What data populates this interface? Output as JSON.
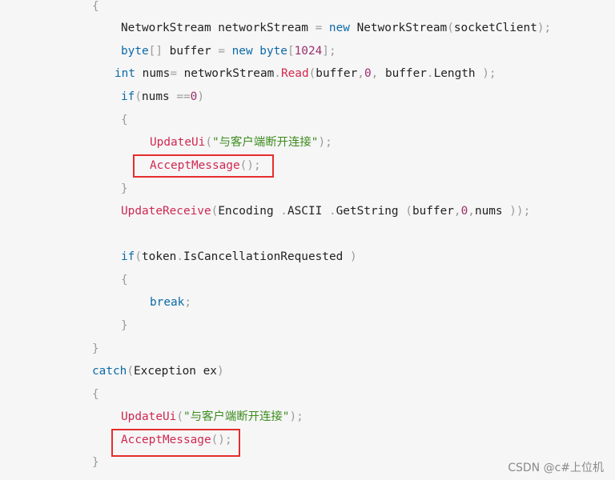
{
  "code": {
    "lines": [
      {
        "tokens": [
          {
            "t": "{",
            "c": "punc"
          }
        ]
      },
      {
        "tokens": [
          {
            "t": "NetworkStream networkStream ",
            "c": "plain"
          },
          {
            "t": "= ",
            "c": "punc"
          },
          {
            "t": "new ",
            "c": "kw"
          },
          {
            "t": "NetworkStream",
            "c": "plain"
          },
          {
            "t": "(",
            "c": "punc"
          },
          {
            "t": "socketClient",
            "c": "plain"
          },
          {
            "t": ");",
            "c": "punc"
          }
        ]
      },
      {
        "tokens": [
          {
            "t": "byte",
            "c": "kw"
          },
          {
            "t": "[] ",
            "c": "punc"
          },
          {
            "t": "buffer ",
            "c": "plain"
          },
          {
            "t": "= ",
            "c": "punc"
          },
          {
            "t": "new ",
            "c": "kw"
          },
          {
            "t": "byte",
            "c": "kw"
          },
          {
            "t": "[",
            "c": "punc"
          },
          {
            "t": "1024",
            "c": "num"
          },
          {
            "t": "];",
            "c": "punc"
          }
        ]
      },
      {
        "tokens": [
          {
            "t": "int ",
            "c": "kw"
          },
          {
            "t": "nums",
            "c": "plain"
          },
          {
            "t": "= ",
            "c": "punc"
          },
          {
            "t": "networkStream",
            "c": "plain"
          },
          {
            "t": ".",
            "c": "punc"
          },
          {
            "t": "Read",
            "c": "fn"
          },
          {
            "t": "(",
            "c": "punc"
          },
          {
            "t": "buffer",
            "c": "plain"
          },
          {
            "t": ",",
            "c": "punc"
          },
          {
            "t": "0",
            "c": "num"
          },
          {
            "t": ", ",
            "c": "punc"
          },
          {
            "t": "buffer",
            "c": "plain"
          },
          {
            "t": ".",
            "c": "punc"
          },
          {
            "t": "Length ",
            "c": "plain"
          },
          {
            "t": ");",
            "c": "punc"
          }
        ]
      },
      {
        "tokens": [
          {
            "t": "if",
            "c": "kw"
          },
          {
            "t": "(",
            "c": "punc"
          },
          {
            "t": "nums ",
            "c": "plain"
          },
          {
            "t": "==",
            "c": "punc"
          },
          {
            "t": "0",
            "c": "num"
          },
          {
            "t": ")",
            "c": "punc"
          }
        ]
      },
      {
        "tokens": [
          {
            "t": "{",
            "c": "punc"
          }
        ]
      },
      {
        "tokens": [
          {
            "t": "UpdateUi",
            "c": "fn"
          },
          {
            "t": "(",
            "c": "punc"
          },
          {
            "t": "\"与客户端断开连接\"",
            "c": "str"
          },
          {
            "t": ");",
            "c": "punc"
          }
        ]
      },
      {
        "tokens": [
          {
            "t": "AcceptMessage",
            "c": "fn"
          },
          {
            "t": "();",
            "c": "punc"
          }
        ]
      },
      {
        "tokens": [
          {
            "t": "}",
            "c": "punc"
          }
        ]
      },
      {
        "tokens": [
          {
            "t": "UpdateReceive",
            "c": "fn"
          },
          {
            "t": "(",
            "c": "punc"
          },
          {
            "t": "Encoding ",
            "c": "plain"
          },
          {
            "t": ".",
            "c": "punc"
          },
          {
            "t": "ASCII ",
            "c": "plain"
          },
          {
            "t": ".",
            "c": "punc"
          },
          {
            "t": "GetString ",
            "c": "plain"
          },
          {
            "t": "(",
            "c": "punc"
          },
          {
            "t": "buffer",
            "c": "plain"
          },
          {
            "t": ",",
            "c": "punc"
          },
          {
            "t": "0",
            "c": "num"
          },
          {
            "t": ",",
            "c": "punc"
          },
          {
            "t": "nums ",
            "c": "plain"
          },
          {
            "t": "));",
            "c": "punc"
          }
        ]
      },
      {
        "tokens": []
      },
      {
        "tokens": [
          {
            "t": "if",
            "c": "kw"
          },
          {
            "t": "(",
            "c": "punc"
          },
          {
            "t": "token",
            "c": "plain"
          },
          {
            "t": ".",
            "c": "punc"
          },
          {
            "t": "IsCancellationRequested ",
            "c": "plain"
          },
          {
            "t": ")",
            "c": "punc"
          }
        ]
      },
      {
        "tokens": [
          {
            "t": "{",
            "c": "punc"
          }
        ]
      },
      {
        "tokens": [
          {
            "t": "break",
            "c": "kw"
          },
          {
            "t": ";",
            "c": "punc"
          }
        ]
      },
      {
        "tokens": [
          {
            "t": "}",
            "c": "punc"
          }
        ]
      },
      {
        "tokens": [
          {
            "t": "}",
            "c": "punc"
          }
        ]
      },
      {
        "tokens": [
          {
            "t": "catch",
            "c": "kw"
          },
          {
            "t": "(",
            "c": "punc"
          },
          {
            "t": "Exception ex",
            "c": "plain"
          },
          {
            "t": ")",
            "c": "punc"
          }
        ]
      },
      {
        "tokens": [
          {
            "t": "{",
            "c": "punc"
          }
        ]
      },
      {
        "tokens": [
          {
            "t": "UpdateUi",
            "c": "fn"
          },
          {
            "t": "(",
            "c": "punc"
          },
          {
            "t": "\"与客户端断开连接\"",
            "c": "str"
          },
          {
            "t": ");",
            "c": "punc"
          }
        ]
      },
      {
        "tokens": [
          {
            "t": "AcceptMessage",
            "c": "fn"
          },
          {
            "t": "();",
            "c": "punc"
          }
        ]
      },
      {
        "tokens": [
          {
            "t": "}",
            "c": "punc"
          }
        ]
      }
    ]
  },
  "highlights": [
    "AcceptMessage();",
    "AcceptMessage();"
  ],
  "watermark": "CSDN @c#上位机"
}
